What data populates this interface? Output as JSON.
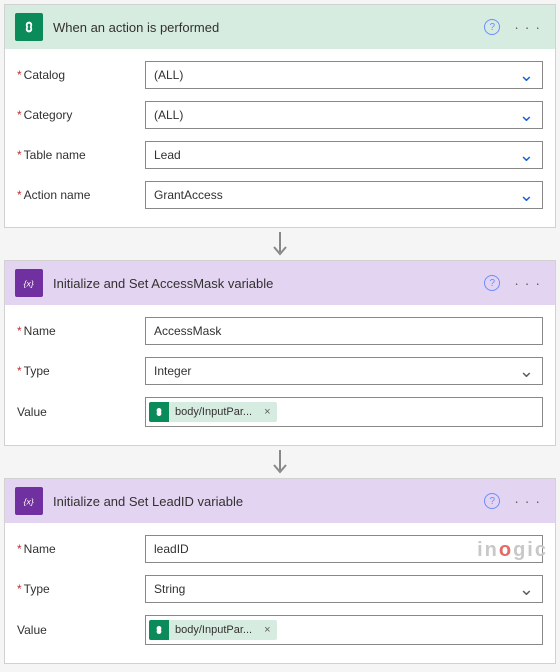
{
  "card1": {
    "title": "When an action is performed",
    "fields": {
      "catalog": {
        "label": "Catalog",
        "value": "(ALL)",
        "required": true
      },
      "category": {
        "label": "Category",
        "value": "(ALL)",
        "required": true
      },
      "table": {
        "label": "Table name",
        "value": "Lead",
        "required": true
      },
      "action": {
        "label": "Action name",
        "value": "GrantAccess",
        "required": true
      }
    }
  },
  "card2": {
    "title": "Initialize and Set AccessMask variable",
    "fields": {
      "name": {
        "label": "Name",
        "value": "AccessMask",
        "required": true
      },
      "type": {
        "label": "Type",
        "value": "Integer",
        "required": true
      },
      "value": {
        "label": "Value",
        "token": "body/InputPar..."
      }
    }
  },
  "card3": {
    "title": "Initialize and Set LeadID variable",
    "fields": {
      "name": {
        "label": "Name",
        "value": "leadID",
        "required": true
      },
      "type": {
        "label": "Type",
        "value": "String",
        "required": true
      },
      "value": {
        "label": "Value",
        "token": "body/InputPar..."
      }
    }
  },
  "icons": {
    "help": "?",
    "more": "· · ·",
    "close": "×"
  },
  "watermark": "inogic"
}
